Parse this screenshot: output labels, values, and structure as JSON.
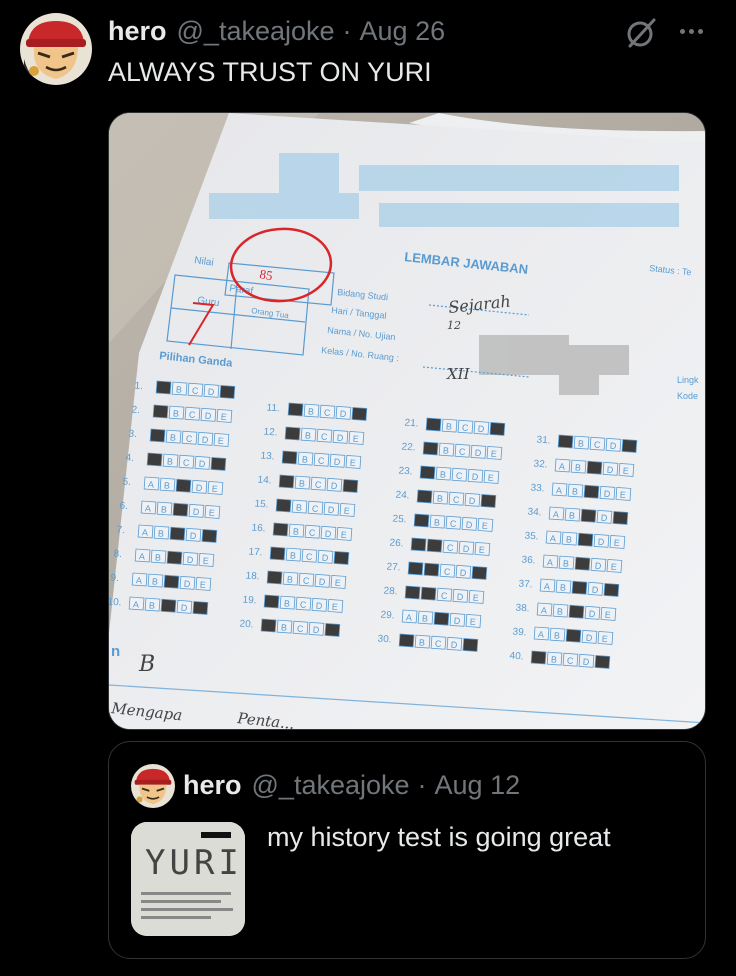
{
  "tweet": {
    "author_name": "hero",
    "handle": "@_takeajoke",
    "separator": "·",
    "date": "Aug 26",
    "text": "ALWAYS TRUST ON YURI"
  },
  "answer_sheet": {
    "title": "LEMBAR JAWABAN",
    "status_label": "Status : Te",
    "nilai_label": "Nilai",
    "score": "85",
    "paraf_label": "Paraf",
    "guru_label": "Guru",
    "orang_tua_label": "Orang Tua",
    "guru_mark": "7",
    "fields": [
      {
        "label": "Bidang Studi",
        "value": "Sejarah"
      },
      {
        "label": "Hari / Tanggal",
        "value": "12"
      },
      {
        "label": "Nama / No. Ujian",
        "value": ""
      },
      {
        "label": "Kelas / No. Ruang :",
        "value": "XII"
      }
    ],
    "side_labels": [
      "Lingk",
      "Kode"
    ],
    "section_label": "Pilihan Ganda",
    "essay_marker": "n",
    "essay_answer": "B",
    "footer_handwriting": [
      "Mengapa",
      "Penta..."
    ],
    "question_numbers": [
      [
        "1.",
        "2.",
        "3.",
        "4.",
        "5.",
        "6.",
        "7.",
        "8.",
        "9.",
        "10."
      ],
      [
        "11.",
        "12.",
        "13.",
        "14.",
        "15.",
        "16.",
        "17.",
        "18.",
        "19.",
        "20."
      ],
      [
        "21.",
        "22.",
        "23.",
        "24.",
        "25.",
        "26.",
        "27.",
        "28.",
        "29.",
        "30."
      ],
      [
        "31.",
        "32.",
        "33.",
        "34.",
        "35.",
        "36.",
        "37.",
        "38.",
        "39.",
        "40."
      ]
    ]
  },
  "quoted_tweet": {
    "author_name": "hero",
    "handle": "@_takeajoke",
    "separator": "·",
    "date": "Aug 12",
    "text": "my history test is going great",
    "thumb_text": "YURI"
  },
  "icons": {
    "grok": "grok-icon",
    "more": "more-icon"
  },
  "colors": {
    "background": "#000000",
    "text_primary": "#e7e9ea",
    "text_secondary": "#71767b",
    "border": "#2f3336",
    "sheet_blue": "#5a9bd0",
    "red_pen": "#d8262a"
  }
}
